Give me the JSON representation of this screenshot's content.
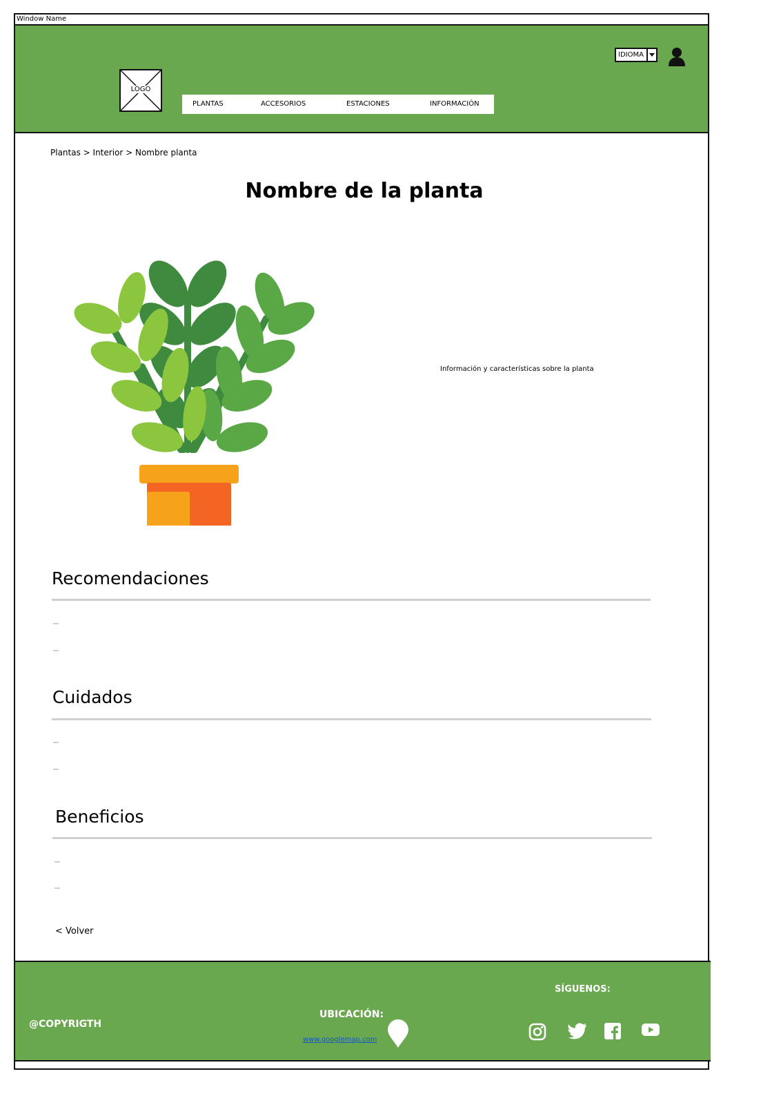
{
  "window": {
    "title": "Window Name"
  },
  "header": {
    "logo_label": "LOGO",
    "nav": [
      "PLANTAS",
      "ACCESORIOS",
      "ESTACIONES",
      "INFORMACIÓN"
    ],
    "language_select": "IDIOMA"
  },
  "breadcrumb": "Plantas > Interior > Nombre planta",
  "main": {
    "title": "Nombre de la planta",
    "info": "Información y características sobre la planta",
    "sections": [
      {
        "title": "Recomendaciones"
      },
      {
        "title": "Cuidados"
      },
      {
        "title": "Beneficios"
      }
    ],
    "back_label": "< Volver"
  },
  "footer": {
    "copyright": "@COPYRIGTH",
    "location_label": "UBICACIÓN:",
    "map_link": "www.googlemap.com",
    "follow_label": "SÍGUENOS:",
    "social_icons": [
      "instagram-icon",
      "twitter-icon",
      "facebook-icon",
      "youtube-icon"
    ]
  },
  "colors": {
    "brand_green": "#6aa84f",
    "leaf_dark": "#3e8a3e",
    "leaf_mid": "#5aa845",
    "leaf_light": "#8cc63f",
    "pot_orange": "#f26522",
    "pot_yellow": "#f7a21b"
  }
}
